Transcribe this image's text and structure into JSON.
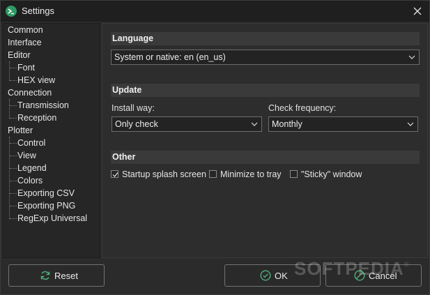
{
  "window": {
    "title": "Settings"
  },
  "sidebar": {
    "items": [
      {
        "label": "Common",
        "level": 0
      },
      {
        "label": "Interface",
        "level": 0
      },
      {
        "label": "Editor",
        "level": 0
      },
      {
        "label": "Font",
        "level": 1
      },
      {
        "label": "HEX view",
        "level": 1
      },
      {
        "label": "Connection",
        "level": 0
      },
      {
        "label": "Transmission",
        "level": 1
      },
      {
        "label": "Reception",
        "level": 1
      },
      {
        "label": "Plotter",
        "level": 0
      },
      {
        "label": "Control",
        "level": 1
      },
      {
        "label": "View",
        "level": 1
      },
      {
        "label": "Legend",
        "level": 1
      },
      {
        "label": "Colors",
        "level": 1
      },
      {
        "label": "Exporting CSV",
        "level": 1
      },
      {
        "label": "Exporting PNG",
        "level": 1
      },
      {
        "label": "RegExp Universal",
        "level": 1
      }
    ]
  },
  "language": {
    "header": "Language",
    "value": "System or native: en (en_us)"
  },
  "update": {
    "header": "Update",
    "install_label": "Install way:",
    "install_value": "Only check",
    "frequency_label": "Check frequency:",
    "frequency_value": "Monthly"
  },
  "other": {
    "header": "Other",
    "options": [
      {
        "label": "Startup splash screen",
        "checked": true
      },
      {
        "label": "Minimize to tray",
        "checked": false
      },
      {
        "label": "\"Sticky\" window",
        "checked": false
      }
    ]
  },
  "buttons": {
    "reset": "Reset",
    "ok": "OK",
    "cancel": "Cancel"
  },
  "watermark": {
    "text": "SOFTPEDIA",
    "mark": "®"
  },
  "colors": {
    "accent": "#2f9a63",
    "background": "#2b2b2b",
    "titlebar": "#1f1f1f"
  },
  "icons": {
    "app": "terminal-icon",
    "close": "close-icon",
    "reset": "refresh-icon",
    "ok": "check-circle-icon",
    "cancel": "cancel-circle-icon"
  }
}
